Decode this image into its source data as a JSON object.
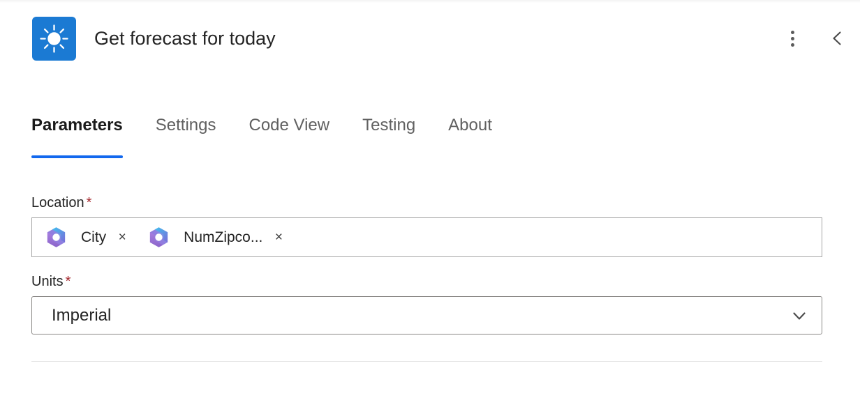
{
  "header": {
    "title": "Get forecast for today",
    "icon": "sun-icon",
    "icon_bg": "#1b7ad3",
    "actions": {
      "more_options": "more-options-icon",
      "collapse": "chevron-left-icon"
    }
  },
  "tabs": {
    "active_index": 0,
    "accent_color": "#1268ee",
    "items": [
      {
        "label": "Parameters"
      },
      {
        "label": "Settings"
      },
      {
        "label": "Code View"
      },
      {
        "label": "Testing"
      },
      {
        "label": "About"
      }
    ]
  },
  "form": {
    "required_marker": "*",
    "required_color": "#a4262c",
    "location": {
      "label": "Location",
      "required": true,
      "chips": [
        {
          "label": "City",
          "icon": "copilot-icon",
          "remove": "×"
        },
        {
          "label": "NumZipco...",
          "icon": "copilot-icon",
          "remove": "×"
        }
      ]
    },
    "units": {
      "label": "Units",
      "required": true,
      "value": "Imperial",
      "chevron": "chevron-down-icon"
    }
  }
}
